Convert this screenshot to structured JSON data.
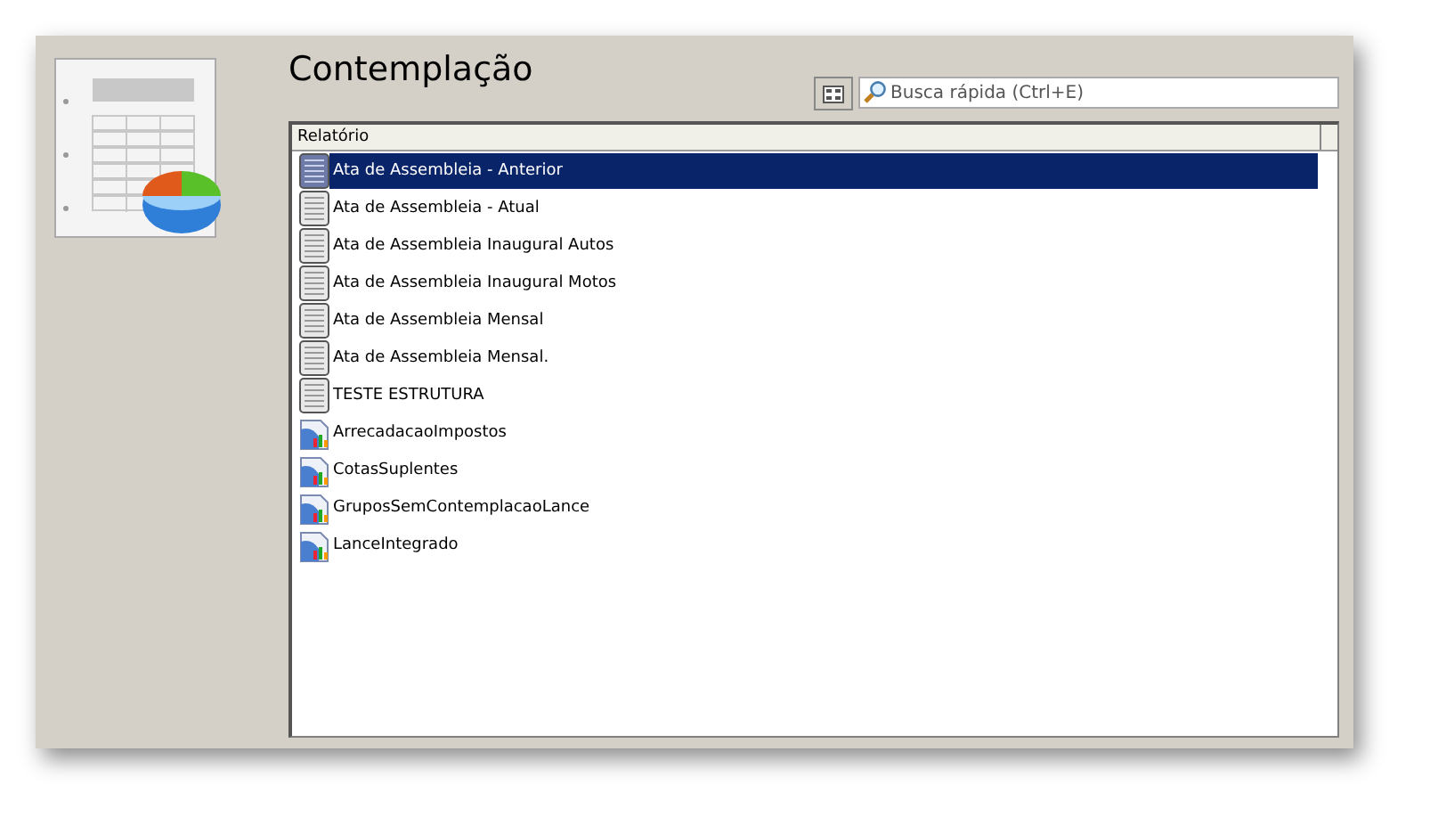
{
  "title": "Contemplação",
  "search": {
    "placeholder": "Busca rápida (Ctrl+E)"
  },
  "table": {
    "columns": [
      "Relatório"
    ],
    "rows": [
      {
        "label": "Ata de Assembleia - Anterior",
        "kind": "document",
        "selected": true
      },
      {
        "label": "Ata de Assembleia - Atual",
        "kind": "document",
        "selected": false
      },
      {
        "label": "Ata de Assembleia Inaugural Autos",
        "kind": "document",
        "selected": false
      },
      {
        "label": "Ata de Assembleia Inaugural Motos",
        "kind": "document",
        "selected": false
      },
      {
        "label": "Ata de Assembleia Mensal",
        "kind": "document",
        "selected": false
      },
      {
        "label": "Ata de Assembleia Mensal.",
        "kind": "document",
        "selected": false
      },
      {
        "label": "TESTE ESTRUTURA",
        "kind": "document",
        "selected": false
      },
      {
        "label": "ArrecadacaoImpostos",
        "kind": "chart",
        "selected": false
      },
      {
        "label": "CotasSuplentes",
        "kind": "chart",
        "selected": false
      },
      {
        "label": "GruposSemContemplacaoLance",
        "kind": "chart",
        "selected": false
      },
      {
        "label": "LanceIntegrado",
        "kind": "chart",
        "selected": false
      }
    ]
  }
}
